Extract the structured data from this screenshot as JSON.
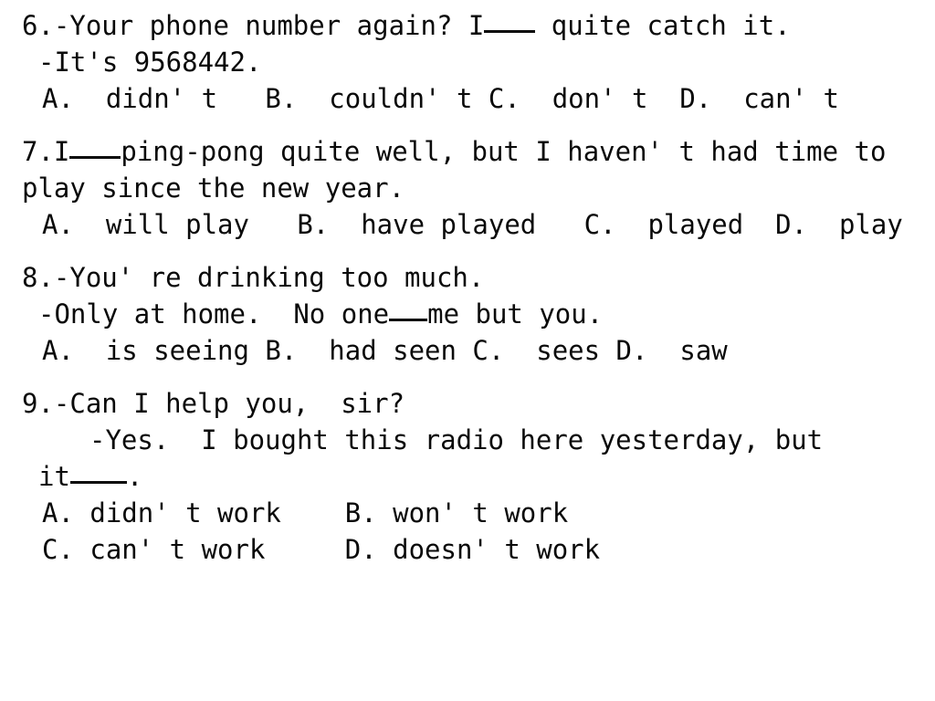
{
  "document": {
    "type": "english-grammar-multiple-choice-exercise",
    "background_color": "#ffffff",
    "text_color": "#0a0a0a"
  },
  "questions": [
    {
      "number": "6.",
      "lines": [
        {
          "kind": "prompt",
          "indent": 0,
          "before": "6.-Your phone number again? I",
          "blank": "w4",
          "after": " quite catch it."
        },
        {
          "kind": "reply",
          "indent": 1,
          "text": "-It's 9568442."
        },
        {
          "kind": "options",
          "indent": 2,
          "text": "A.  didn' t   B.  couldn' t C.  don' t  D.  can' t"
        }
      ],
      "options": [
        {
          "label": "A.",
          "text": "didn' t"
        },
        {
          "label": "B.",
          "text": "couldn' t"
        },
        {
          "label": "C.",
          "text": "don' t"
        },
        {
          "label": "D.",
          "text": "can' t"
        }
      ]
    },
    {
      "number": "7.",
      "lines": [
        {
          "kind": "prompt",
          "indent": 0,
          "before": "7.I",
          "blank": "w4",
          "after": "ping-pong quite well, but I haven' t had time to"
        },
        {
          "kind": "continue",
          "indent": 0,
          "text": "play since the new year."
        },
        {
          "kind": "options",
          "indent": 2,
          "text": "A.  will play   B.  have played   C.  played  D.  play"
        }
      ],
      "options": [
        {
          "label": "A.",
          "text": "will play"
        },
        {
          "label": "B.",
          "text": "have played"
        },
        {
          "label": "C.",
          "text": "played"
        },
        {
          "label": "D.",
          "text": "play"
        }
      ]
    },
    {
      "number": "8.",
      "lines": [
        {
          "kind": "prompt",
          "indent": 0,
          "text": "8.-You' re drinking too much."
        },
        {
          "kind": "reply",
          "indent": 1,
          "before": "-Only at home.  No one",
          "blank": "w3",
          "after": "me but you."
        },
        {
          "kind": "options",
          "indent": 2,
          "text": "A.  is seeing B.  had seen C.  sees D.  saw"
        }
      ],
      "options": [
        {
          "label": "A.",
          "text": "is seeing"
        },
        {
          "label": "B.",
          "text": "had seen"
        },
        {
          "label": "C.",
          "text": "sees"
        },
        {
          "label": "D.",
          "text": "saw"
        }
      ]
    },
    {
      "number": "9.",
      "lines": [
        {
          "kind": "prompt",
          "indent": 0,
          "text": "9.-Can I help you,  sir?"
        },
        {
          "kind": "reply",
          "indent": 4,
          "text": "-Yes.  I bought this radio here yesterday, but"
        },
        {
          "kind": "continue",
          "indent": 1,
          "before": "it",
          "blank": "w5",
          "after": "."
        },
        {
          "kind": "options",
          "indent": 2,
          "text": "A. didn' t work    B. won' t work"
        },
        {
          "kind": "options",
          "indent": 2,
          "text": "C. can' t work     D. doesn' t work"
        }
      ],
      "options": [
        {
          "label": "A.",
          "text": "didn' t work"
        },
        {
          "label": "B.",
          "text": "won' t work"
        },
        {
          "label": "C.",
          "text": "can' t work"
        },
        {
          "label": "D.",
          "text": "doesn' t work"
        }
      ]
    }
  ]
}
